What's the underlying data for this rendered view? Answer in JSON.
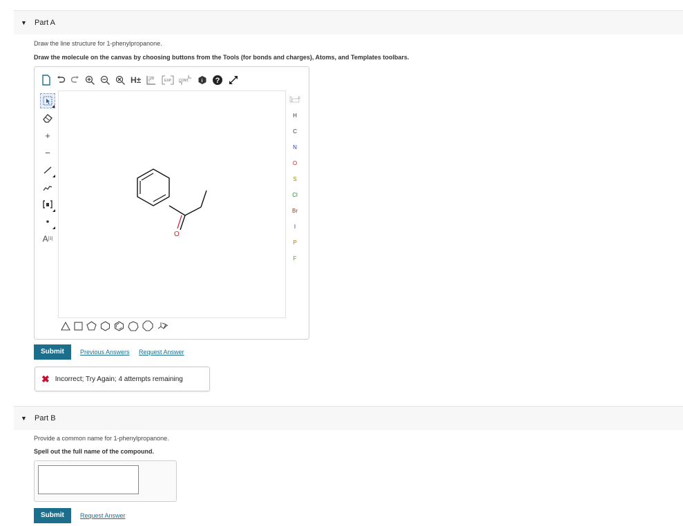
{
  "partA": {
    "title": "Part A",
    "prompt": "Draw the line structure for 1-phenylpropanone.",
    "instruction": "Draw the molecule on the canvas by choosing buttons from the Tools (for bonds and charges), Atoms, and Templates toolbars.",
    "toolbar": {
      "top": {
        "h_label": "H±",
        "two_d_label": "2D",
        "exp_label": "EXP.",
        "cont_label": "CONT.",
        "info_icon": "info-icon",
        "help_icon": "help-icon",
        "fullscreen_icon": "expand-icon"
      },
      "left": {
        "plus": "+",
        "minus": "−",
        "atom_label": "A",
        "atom_index": "[1]"
      },
      "atoms": [
        "H",
        "C",
        "N",
        "O",
        "S",
        "Cl",
        "Br",
        "I",
        "P",
        "F"
      ],
      "atom_colors": {
        "H": "#333333",
        "C": "#333333",
        "N": "#1f3fd1",
        "O": "#d41a1a",
        "S": "#9a8a00",
        "Cl": "#1f8a1f",
        "Br": "#8a3a1a",
        "I": "#6a1a8a",
        "P": "#d46a00",
        "F": "#5aa01a"
      }
    },
    "molecule": {
      "oxygen_label": "O"
    },
    "submit_label": "Submit",
    "previous_answers_label": "Previous Answers",
    "request_answer_label": "Request Answer",
    "feedback": {
      "icon": "x-icon",
      "message": "Incorrect; Try Again; 4 attempts remaining"
    }
  },
  "partB": {
    "title": "Part B",
    "prompt": "Provide a common name for 1-phenylpropanone.",
    "instruction": "Spell out the full name of the compound.",
    "answer_value": "",
    "submit_label": "Submit",
    "request_answer_label": "Request Answer"
  },
  "colors": {
    "accent": "#1c6f8c",
    "error": "#c8102e",
    "header_bg": "#f7f7f7"
  }
}
